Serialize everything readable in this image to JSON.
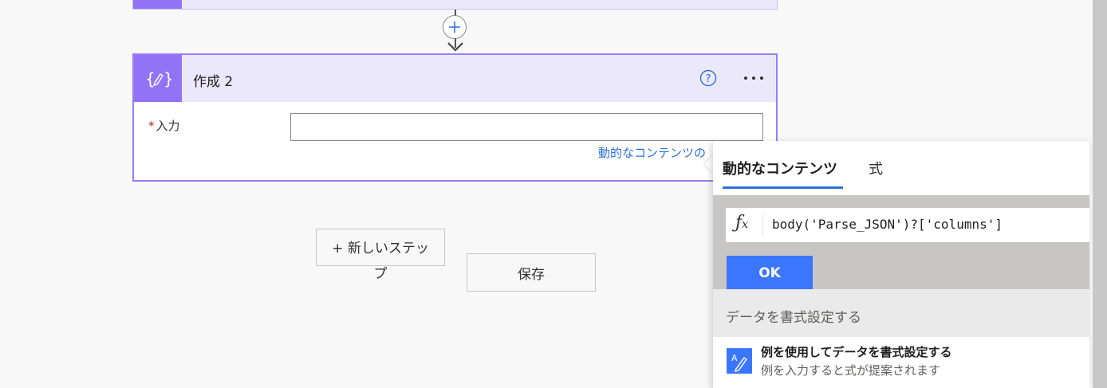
{
  "card": {
    "title": "作成 2",
    "input_label": "入力",
    "required_marker": "*",
    "input_value": "",
    "dynamic_link": "動的なコンテンツの"
  },
  "actions": {
    "new_step_line1": "+ 新しいステッ",
    "new_step_line2": "プ",
    "save": "保存"
  },
  "panel": {
    "tabs": [
      "動的なコンテンツ",
      "式"
    ],
    "active_tab": "動的なコンテンツ",
    "expression": "body('Parse_JSON')?['columns']",
    "ok_label": "OK",
    "format_heading": "データを書式設定する",
    "example_title": "例を使用してデータを書式設定する",
    "example_subtitle": "例を入力すると式が提案されます"
  },
  "icons": {
    "card_icon": "compose-icon",
    "help": "help-icon",
    "more": "more-icon",
    "add": "add-step-icon",
    "fx": "fx-icon",
    "format": "format-data-icon"
  },
  "colors": {
    "accent_purple": "#9273f6",
    "header_bg": "#ece8fb",
    "link_blue": "#2f6fd6",
    "ok_blue": "#3b76ff"
  }
}
